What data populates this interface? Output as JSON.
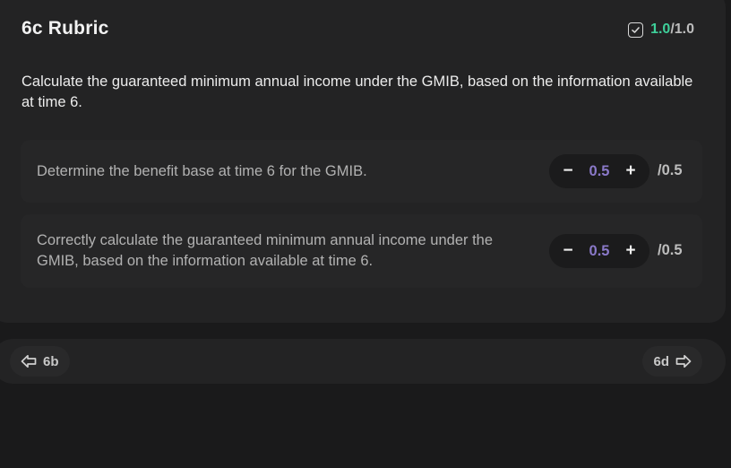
{
  "header": {
    "title": "6c Rubric",
    "score_got": "1.0",
    "score_total": "/1.0",
    "check_icon": "checkbox-check-icon"
  },
  "question": "Calculate the guaranteed minimum annual income under the GMIB, based on the information available at time 6.",
  "criteria": [
    {
      "text": "Determine the benefit base at time 6 for the GMIB.",
      "minus": "−",
      "value": "0.5",
      "plus": "+",
      "max": "/0.5"
    },
    {
      "text": "Correctly calculate the guaranteed minimum annual income under the GMIB, based on the information available at time 6.",
      "minus": "−",
      "value": "0.5",
      "plus": "+",
      "max": "/0.5"
    }
  ],
  "nav": {
    "prev_label": "6b",
    "next_label": "6d",
    "prev_icon": "arrow-left-icon",
    "next_icon": "arrow-right-icon"
  },
  "colors": {
    "background": "#1a1a1b",
    "card": "#232324",
    "score_accent": "#3ecf9a",
    "stepper_value": "#8a79c9"
  }
}
